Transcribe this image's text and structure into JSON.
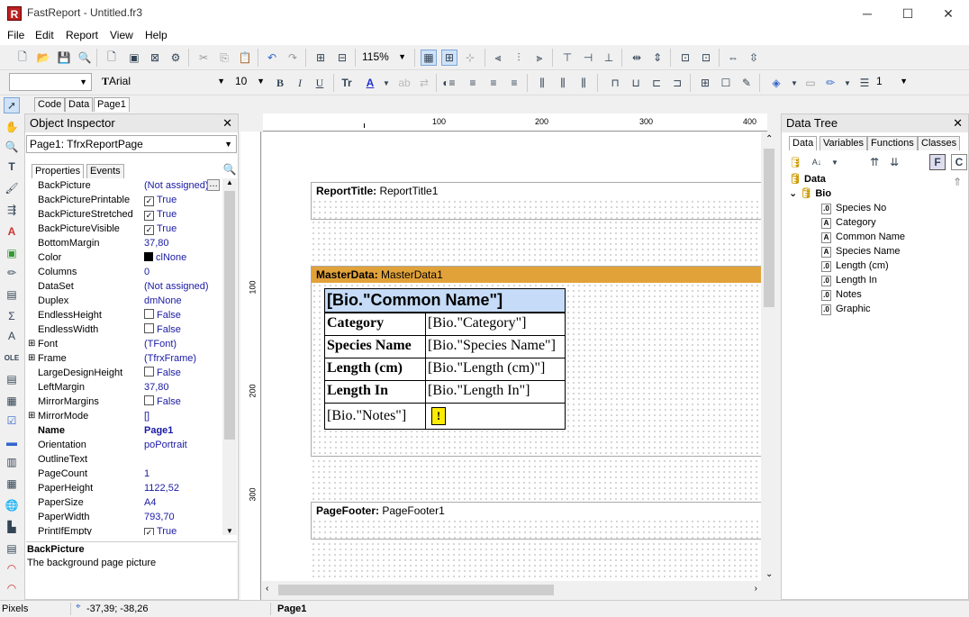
{
  "window": {
    "title": "FastReport - Untitled.fr3",
    "minimize": "─",
    "maximize": "☐",
    "close": "✕"
  },
  "menu": [
    "File",
    "Edit",
    "Report",
    "View",
    "Help"
  ],
  "toolbar": {
    "zoom": "115%",
    "font_name": "Arial",
    "font_size": "10",
    "line_width": "1"
  },
  "doc_tabs": [
    "Code",
    "Data",
    "Page1"
  ],
  "object_inspector": {
    "title": "Object Inspector",
    "selected_object": "Page1: TfrxReportPage",
    "tabs": [
      "Properties",
      "Events"
    ],
    "properties": [
      {
        "name": "BackPicture",
        "value": "(Not assigned)",
        "type": "ellipsis"
      },
      {
        "name": "BackPicturePrintable",
        "value": "True",
        "type": "check",
        "checked": true
      },
      {
        "name": "BackPictureStretched",
        "value": "True",
        "type": "check",
        "checked": true
      },
      {
        "name": "BackPictureVisible",
        "value": "True",
        "type": "check",
        "checked": true
      },
      {
        "name": "BottomMargin",
        "value": "37,80"
      },
      {
        "name": "Color",
        "value": "clNone",
        "type": "color"
      },
      {
        "name": "Columns",
        "value": "0"
      },
      {
        "name": "DataSet",
        "value": "(Not assigned)"
      },
      {
        "name": "Duplex",
        "value": "dmNone"
      },
      {
        "name": "EndlessHeight",
        "value": "False",
        "type": "check",
        "checked": false
      },
      {
        "name": "EndlessWidth",
        "value": "False",
        "type": "check",
        "checked": false
      },
      {
        "name": "Font",
        "value": "(TFont)",
        "type": "expand"
      },
      {
        "name": "Frame",
        "value": "(TfrxFrame)",
        "type": "expand"
      },
      {
        "name": "LargeDesignHeight",
        "value": "False",
        "type": "check",
        "checked": false
      },
      {
        "name": "LeftMargin",
        "value": "37,80"
      },
      {
        "name": "MirrorMargins",
        "value": "False",
        "type": "check",
        "checked": false
      },
      {
        "name": "MirrorMode",
        "value": "[]",
        "type": "expand"
      },
      {
        "name": "Name",
        "value": "Page1",
        "type": "bold"
      },
      {
        "name": "Orientation",
        "value": "poPortrait"
      },
      {
        "name": "OutlineText",
        "value": ""
      },
      {
        "name": "PageCount",
        "value": "1"
      },
      {
        "name": "PaperHeight",
        "value": "1122,52"
      },
      {
        "name": "PaperSize",
        "value": "A4"
      },
      {
        "name": "PaperWidth",
        "value": "793,70"
      },
      {
        "name": "PrintIfEmpty",
        "value": "True",
        "type": "check",
        "checked": true
      }
    ],
    "help_title": "BackPicture",
    "help_text": "The background page picture"
  },
  "ruler": {
    "top": [
      "100",
      "200",
      "300",
      "400"
    ],
    "left": [
      "100",
      "200",
      "300"
    ]
  },
  "bands": {
    "report_title": {
      "type": "ReportTitle:",
      "name": "ReportTitle1"
    },
    "master_data": {
      "type": "MasterData:",
      "name": "MasterData1"
    },
    "page_footer": {
      "type": "PageFooter:",
      "name": "PageFooter1"
    }
  },
  "memo": {
    "header": "[Bio.\"Common Name\"]",
    "rows": [
      {
        "label": "Category",
        "value": "[Bio.\"Category\"]"
      },
      {
        "label": "Species Name",
        "value": "[Bio.\"Species Name\"]"
      },
      {
        "label": "Length (cm)",
        "value": "[Bio.\"Length (cm)\"]"
      },
      {
        "label": "Length In",
        "value": "[Bio.\"Length In\"]"
      }
    ],
    "notes": "[Bio.\"Notes\"]"
  },
  "data_tree": {
    "title": "Data Tree",
    "tabs": [
      "Data",
      "Variables",
      "Functions",
      "Classes"
    ],
    "root": "Data",
    "dataset": "Bio",
    "fields": [
      {
        "name": "Species No",
        "kind": "num"
      },
      {
        "name": "Category",
        "kind": "text"
      },
      {
        "name": "Common Name",
        "kind": "text"
      },
      {
        "name": "Species Name",
        "kind": "text"
      },
      {
        "name": "Length (cm)",
        "kind": "num"
      },
      {
        "name": "Length In",
        "kind": "num"
      },
      {
        "name": "Notes",
        "kind": "num"
      },
      {
        "name": "Graphic",
        "kind": "num"
      }
    ]
  },
  "status": {
    "units": "Pixels",
    "coords": "-37,39; -38,26",
    "page": "Page1"
  }
}
